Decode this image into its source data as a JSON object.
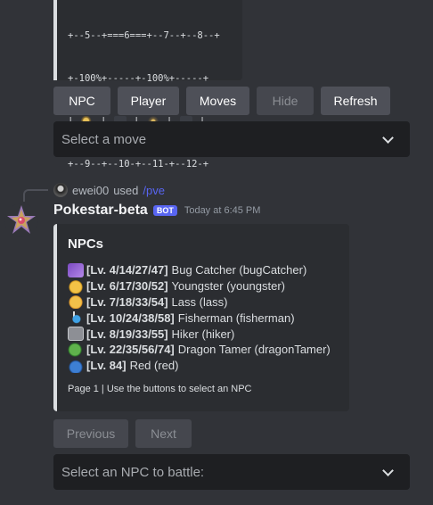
{
  "board": {
    "lines": [
      "+--5--+===6===+--7--+--8--+",
      "+-100%+-----+-100%+-----+",
      "|  [s]  |  [ ]  |  [s]  |  [ ]  |",
      "+--9--+--10-+--11-+--12-+"
    ]
  },
  "top_buttons": {
    "npc": "NPC",
    "player": "Player",
    "moves": "Moves",
    "hide": "Hide",
    "refresh": "Refresh"
  },
  "move_select": {
    "placeholder": "Select a move"
  },
  "reply": {
    "user": "ewei00",
    "used": "used",
    "command": "/pve"
  },
  "message": {
    "username": "Pokestar-beta",
    "bot_tag": "BOT",
    "timestamp": "Today at 6:45 PM"
  },
  "embed": {
    "title": "NPCs",
    "npcs": [
      {
        "icon": "bug-icon",
        "level": "[Lv. 4/14/27/47]",
        "name": "Bug Catcher (bugCatcher)"
      },
      {
        "icon": "youngster-icon",
        "level": "[Lv. 6/17/30/52]",
        "name": "Youngster (youngster)"
      },
      {
        "icon": "lass-icon",
        "level": "[Lv. 7/18/33/54]",
        "name": "Lass (lass)"
      },
      {
        "icon": "fishing-icon",
        "level": "[Lv. 10/24/38/58]",
        "name": "Fisherman (fisherman)"
      },
      {
        "icon": "rock-icon",
        "level": "[Lv. 8/19/33/55]",
        "name": "Hiker (hiker)"
      },
      {
        "icon": "dragon-icon",
        "level": "[Lv. 22/35/56/74]",
        "name": "Dragon Tamer (dragonTamer)"
      },
      {
        "icon": "cap-icon",
        "level": "[Lv. 84]",
        "name": "Red (red)"
      }
    ],
    "footer": "Page 1 | Use the buttons to select an NPC"
  },
  "pager": {
    "previous": "Previous",
    "next": "Next"
  },
  "npc_select": {
    "placeholder": "Select an NPC to battle:"
  },
  "colors": {
    "background": "#313338",
    "embed": "#2b2d31",
    "button": "#4e5058",
    "blurple": "#5865f2"
  }
}
